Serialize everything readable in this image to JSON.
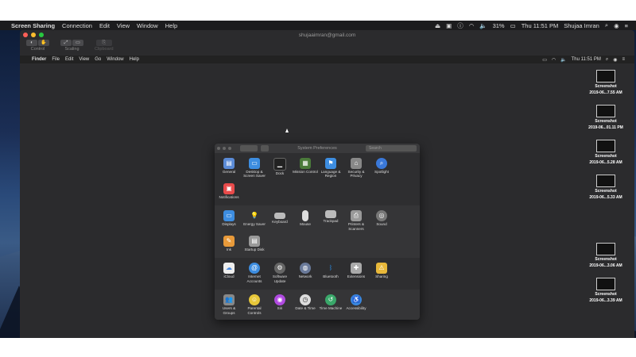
{
  "host_menubar": {
    "app": "Screen Sharing",
    "menus": [
      "Connection",
      "Edit",
      "View",
      "Window",
      "Help"
    ],
    "battery": "31%",
    "clock": "Thu 11:51 PM",
    "user": "Shujaa Imran"
  },
  "window": {
    "title": "shujaaimran@gmail.com",
    "toolbar": [
      {
        "label": "Control"
      },
      {
        "label": "Scaling"
      },
      {
        "label": "Clipboard"
      }
    ]
  },
  "remote_menubar": {
    "app": "Finder",
    "menus": [
      "File",
      "Edit",
      "View",
      "Go",
      "Window",
      "Help"
    ],
    "clock": "Thu 11:51 PM"
  },
  "desktop_icons": [
    {
      "name": "Screenshot",
      "date": "2019-06...7.55 AM"
    },
    {
      "name": "Screenshot",
      "date": "2019-06...01.11 PM"
    },
    {
      "name": "Screenshot",
      "date": "2019-06...5.28 AM"
    },
    {
      "name": "Screenshot",
      "date": "2019-06...5.33 AM"
    },
    {
      "name": "Screenshot",
      "date": "2019-06...3.06 AM"
    },
    {
      "name": "Screenshot",
      "date": "2019-06...3.39 AM"
    }
  ],
  "prefs": {
    "title": "System Preferences",
    "search_placeholder": "Search",
    "row1": [
      {
        "label": "General",
        "icon": "general-icon",
        "color": "#5b8bd6"
      },
      {
        "label": "Desktop & Screen Saver",
        "icon": "desktop-icon",
        "color": "#3d8de0"
      },
      {
        "label": "Dock",
        "icon": "dock-icon",
        "color": "#222"
      },
      {
        "label": "Mission Control",
        "icon": "mission-control-icon",
        "color": "#4a7a3a"
      },
      {
        "label": "Language & Region",
        "icon": "flag-icon",
        "color": "#3d8de0"
      },
      {
        "label": "Security & Privacy",
        "icon": "house-icon",
        "color": "#888"
      },
      {
        "label": "Spotlight",
        "icon": "spotlight-icon",
        "color": "#3a78d8"
      },
      {
        "label": "Notifications",
        "icon": "notifications-icon",
        "color": "#e84a4a"
      }
    ],
    "row2": [
      {
        "label": "Displays",
        "icon": "display-icon",
        "color": "#3d8de0"
      },
      {
        "label": "Energy Saver",
        "icon": "bulb-icon",
        "color": "#d8c84a"
      },
      {
        "label": "Keyboard",
        "icon": "keyboard-icon",
        "color": "#bbb"
      },
      {
        "label": "Mouse",
        "icon": "mouse-icon",
        "color": "#ddd"
      },
      {
        "label": "Trackpad",
        "icon": "trackpad-icon",
        "color": "#bbb"
      },
      {
        "label": "Printers & Scanners",
        "icon": "printer-icon",
        "color": "#999"
      },
      {
        "label": "Sound",
        "icon": "speaker-icon",
        "color": "#777"
      },
      {
        "label": "Ink",
        "icon": "ink-icon",
        "color": "#e89a3a"
      },
      {
        "label": "Startup Disk",
        "icon": "disk-icon",
        "color": "#999"
      }
    ],
    "row3": [
      {
        "label": "iCloud",
        "icon": "cloud-icon",
        "color": "#4a8ae0"
      },
      {
        "label": "Internet Accounts",
        "icon": "at-icon",
        "color": "#3d8de0"
      },
      {
        "label": "Software Update",
        "icon": "gear-icon",
        "color": "#666"
      },
      {
        "label": "Network",
        "icon": "globe-icon",
        "color": "#6a7a9a"
      },
      {
        "label": "Bluetooth",
        "icon": "bluetooth-icon",
        "color": "#2a7ae0"
      },
      {
        "label": "Extensions",
        "icon": "puzzle-icon",
        "color": "#aaa"
      },
      {
        "label": "Sharing",
        "icon": "sharing-icon",
        "color": "#e8b83a"
      }
    ],
    "row4": [
      {
        "label": "Users & Groups",
        "icon": "users-icon",
        "color": "#888"
      },
      {
        "label": "Parental Controls",
        "icon": "parental-icon",
        "color": "#e8c83a"
      },
      {
        "label": "Siri",
        "icon": "siri-icon",
        "color": "#b04ae0"
      },
      {
        "label": "Date & Time",
        "icon": "clock-icon",
        "color": "#ddd"
      },
      {
        "label": "Time Machine",
        "icon": "time-machine-icon",
        "color": "#3aa86a"
      },
      {
        "label": "Accessibility",
        "icon": "accessibility-icon",
        "color": "#3a88e0"
      }
    ]
  },
  "colors": {
    "close": "#ff5f57",
    "minimize": "#febc2e",
    "zoom": "#28c840"
  }
}
